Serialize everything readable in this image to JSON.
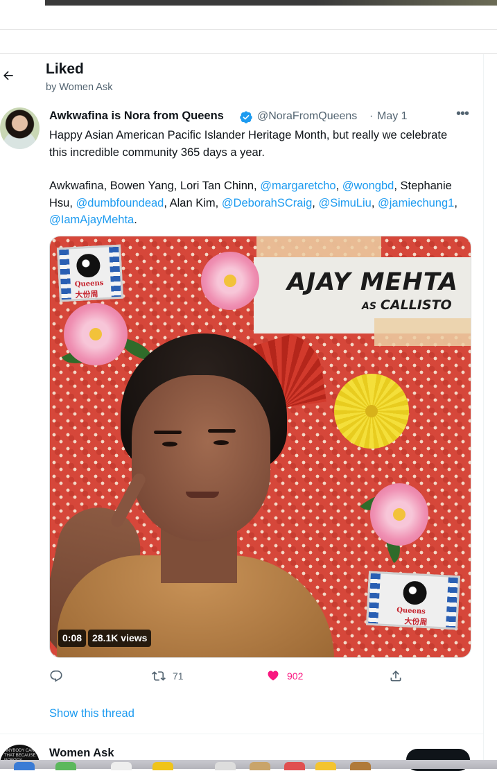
{
  "header": {
    "title": "Liked",
    "subtitle": "by Women Ask"
  },
  "tweet": {
    "author_name": "Awkwafina is Nora from Queens",
    "handle": "@NoraFromQueens",
    "separator": "·",
    "date": "May 1",
    "text_line1": "Happy Asian American Pacific Islander Heritage Month, but really we celebrate this incredible community 365 days a year.",
    "names": {
      "n1": "Awkwafina, Bowen Yang, Lori Tan Chinn, ",
      "m1": "@margaretcho",
      "s1": ", ",
      "m2": "@wongbd",
      "s2": ", Stephanie Hsu, ",
      "m3": "@dumbfoundead",
      "s3": ", Alan Kim, ",
      "m4": "@DeborahSCraig",
      "s4": ", ",
      "m5": "@SimuLiu",
      "s5": ", ",
      "m6": "@jamiechung1",
      "s6": ", ",
      "m7": "@IamAjayMehta",
      "s7": "."
    },
    "media": {
      "card_title": "AJAY MEHTA",
      "card_as": "AS",
      "card_role": "CALLISTO",
      "logo_text": "Queens",
      "logo_cn": "大份周",
      "duration": "0:08",
      "views": "28.1K views"
    },
    "actions": {
      "reply_count": "",
      "retweet_count": "71",
      "like_count": "902"
    },
    "show_thread": "Show this thread"
  },
  "next_tweet": {
    "author_name": "Women Ask",
    "avatar_text": "ANYBODY CAN THAT BECAUSE NOBODY"
  },
  "colors": {
    "link": "#1d9bf0",
    "like": "#f91880",
    "muted": "#536471",
    "text": "#0f1419"
  },
  "icons": {
    "back": "arrow-left-icon",
    "verified": "verified-badge-icon",
    "more": "more-horizontal-icon",
    "reply": "reply-icon",
    "retweet": "retweet-icon",
    "like": "heart-icon",
    "share": "share-icon"
  }
}
